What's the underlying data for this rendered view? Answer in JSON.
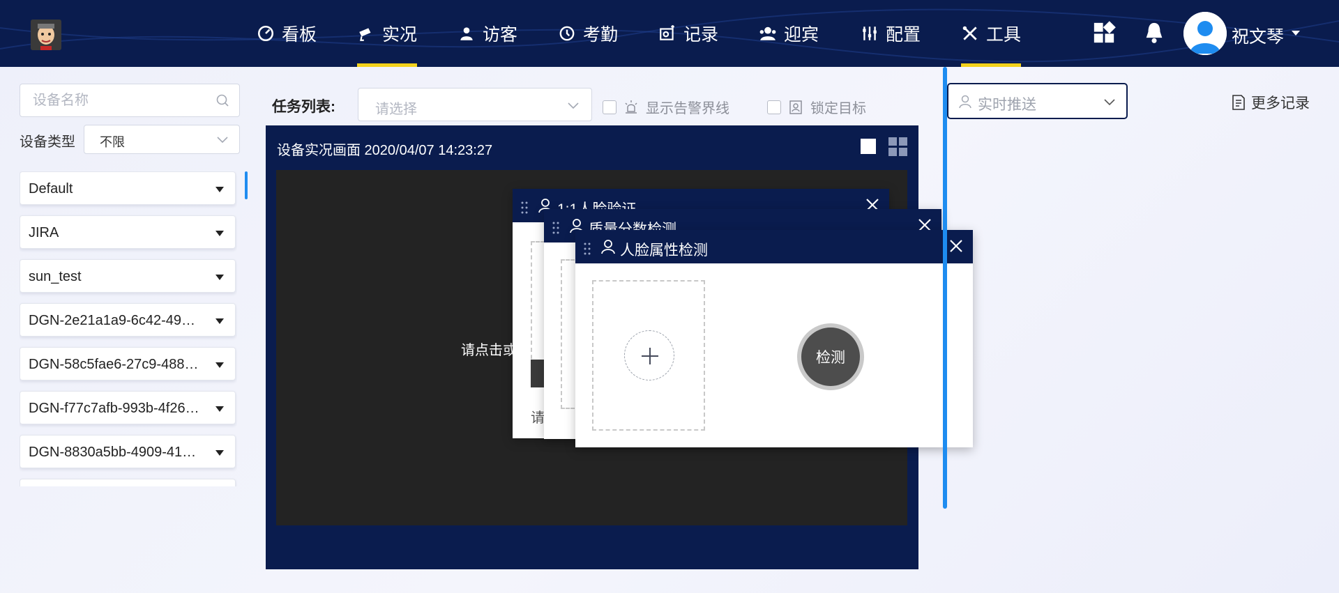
{
  "header": {
    "nav": [
      {
        "label": "看板",
        "icon": "dashboard-icon"
      },
      {
        "label": "实况",
        "icon": "camera-icon",
        "active": true
      },
      {
        "label": "访客",
        "icon": "visitor-icon"
      },
      {
        "label": "考勤",
        "icon": "attendance-icon"
      },
      {
        "label": "记录",
        "icon": "record-icon"
      },
      {
        "label": "迎宾",
        "icon": "welcome-icon"
      },
      {
        "label": "配置",
        "icon": "config-icon"
      },
      {
        "label": "工具",
        "icon": "tools-icon",
        "active": true
      }
    ],
    "user": {
      "name": "祝文琴"
    },
    "colors": {
      "bar": "#0a1c4e",
      "active_underline": "#f3d21b"
    }
  },
  "sidebar": {
    "search_placeholder": "设备名称",
    "type_label": "设备类型",
    "type_value": "不限",
    "devices": [
      "Default",
      "JIRA",
      "sun_test",
      "DGN-2e21a1a9-6c42-49…",
      "DGN-58c5fae6-27c9-488…",
      "DGN-f77c7afb-993b-4f26…",
      "DGN-8830a5bb-4909-41…"
    ]
  },
  "toolbar": {
    "task_label": "任务列表:",
    "task_placeholder": "请选择",
    "show_alert_line": "显示告警界线",
    "lock_target": "锁定目标"
  },
  "video": {
    "title": "设备实况画面 2020/04/07 14:23:27",
    "hint": "请点击或"
  },
  "dialogs": {
    "face_verify": {
      "title": "1:1人脸验证",
      "hint": "请"
    },
    "quality_score": {
      "title": "质量分数检测"
    },
    "face_attr": {
      "title": "人脸属性检测",
      "detect_label": "检测"
    }
  },
  "right_panel": {
    "push_placeholder": "实时推送",
    "more_records": "更多记录",
    "accent": "#1e8cf0"
  }
}
